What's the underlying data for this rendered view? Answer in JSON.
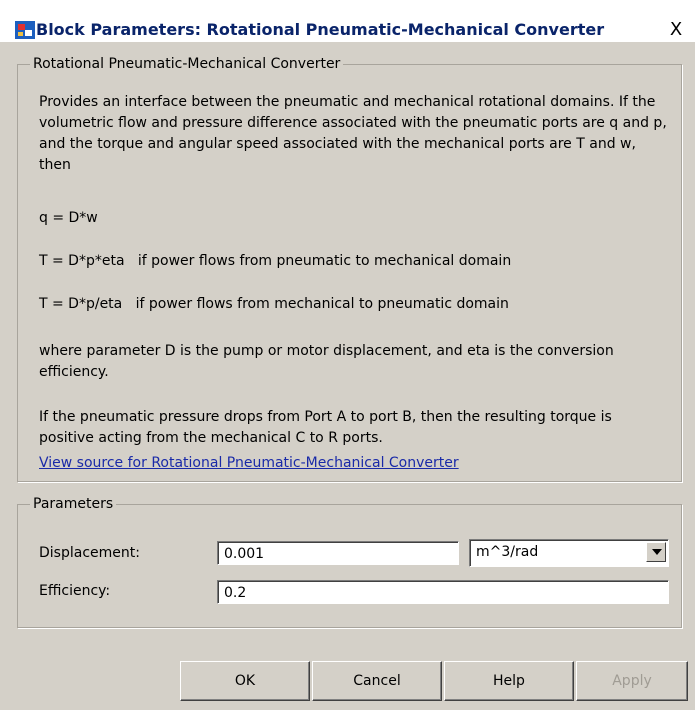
{
  "window": {
    "title": "Block Parameters: Rotational Pneumatic-Mechanical Converter",
    "close_glyph": "X"
  },
  "description": {
    "group_title": "Rotational Pneumatic-Mechanical Converter",
    "paragraph1": "Provides an interface between the pneumatic and mechanical rotational domains. If the volumetric flow and pressure difference associated with the pneumatic ports are q and p, and the torque and angular speed associated with the mechanical ports are T and w, then",
    "eq1": "q = D*w",
    "eq2": "T = D*p*eta   if power flows from pneumatic to mechanical domain",
    "eq3": "T = D*p/eta   if power flows from mechanical to pneumatic domain",
    "paragraph2": "where parameter D is the pump or motor displacement, and eta is the conversion efficiency.",
    "paragraph3": "If the pneumatic pressure drops from Port A to port B, then the resulting torque is positive acting from the mechanical C to R ports.",
    "link": "View source for Rotational Pneumatic-Mechanical Converter"
  },
  "parameters": {
    "group_title": "Parameters",
    "displacement_label": "Displacement:",
    "displacement_value": "0.001",
    "displacement_unit": "m^3/rad",
    "efficiency_label": "Efficiency:",
    "efficiency_value": "0.2"
  },
  "buttons": {
    "ok": "OK",
    "cancel": "Cancel",
    "help": "Help",
    "apply": "Apply"
  },
  "colors": {
    "title_text": "#0a246a",
    "dialog_bg": "#d4d0c8",
    "link": "#1a2aa8",
    "disabled_text": "#a09c94"
  },
  "icons": {
    "app": "simulink-block-icon",
    "dropdown": "chevron-down-icon"
  }
}
